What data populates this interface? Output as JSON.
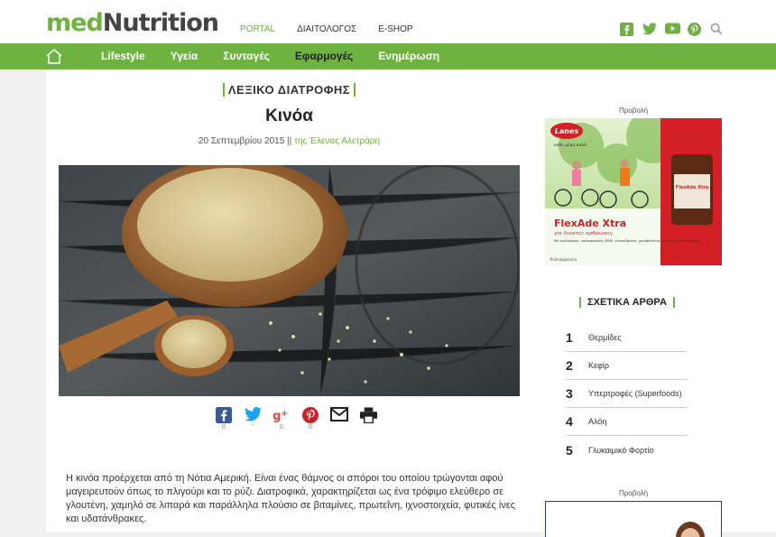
{
  "header": {
    "logo_med": "med",
    "logo_nutrition": "Nutrition",
    "nav": [
      "PORTAL",
      "ΔΙΑΙΤΟΛΟΓΟΣ",
      "E-SHOP"
    ],
    "social_icons": [
      "facebook-icon",
      "twitter-icon",
      "youtube-icon",
      "pinterest-icon",
      "search-icon"
    ]
  },
  "main_nav": [
    "Lifestyle",
    "Υγεία",
    "Συνταγές",
    "Εφαρμογές",
    "Ενημέρωση"
  ],
  "article": {
    "category": "ΛΕΞΙΚΟ ΔΙΑΤΡΟΦΗΣ",
    "title": "Κινόα",
    "date": "20 Σεπτεμβρίου 2015 ||",
    "author": "της Έλενας Αλετράρη",
    "share": [
      {
        "icon": "facebook-icon",
        "count": "0"
      },
      {
        "icon": "twitter-icon",
        "count": "-"
      },
      {
        "icon": "googleplus-icon",
        "count": "0"
      },
      {
        "icon": "pinterest-icon",
        "count": "0"
      },
      {
        "icon": "mail-icon",
        "count": ""
      },
      {
        "icon": "print-icon",
        "count": ""
      }
    ],
    "body": "Η κινόα προέρχεται από τη Νότια Αμερική. Είναι ένας θάμνος οι σπόροι του οποίου τρώγονται αφού μαγειρευτούν όπως το πλιγούρι και το ρύζι. Διατροφικά, χαρακτηρίζεται ως ένα τρόφιμο ελεύθερο σε γλουτένη, χαμηλό σε λιπαρά και παράλληλα πλούσιο σε βιταμίνες, πρωτεΐνη, ιχνοστοιχεία, φυτικές ίνες και υδατάνθρακες."
  },
  "sidebar": {
    "ad_label": "Προβολή",
    "ad": {
      "brand": "Lanes",
      "tagline": "κάθε μέρα καλά",
      "product": "FlexAde Xtra",
      "subtitle": "για δυνατές αρθρώσεις.",
      "description": "Με κολλαγόνο, υαλουρονικό, MSM, γλυκοζαμίνη, χονδροϊτίνη, μαγγάνιο & βιταμίνη C.",
      "hashtag": "#elmaigiasena",
      "bottle_label": "FlexAde Xtra"
    },
    "related_title": "ΣΧΕΤΙΚΑ ΑΡΘΡΑ",
    "related": [
      {
        "num": "1",
        "title": "Θερμίδες"
      },
      {
        "num": "2",
        "title": "Κεφίρ"
      },
      {
        "num": "3",
        "title": "Υπερτροφές (Superfoods)"
      },
      {
        "num": "4",
        "title": "Αλόη"
      },
      {
        "num": "5",
        "title": "Γλυκαιμικό Φορτίο"
      }
    ],
    "ad2_label": "Προβολή"
  },
  "colors": {
    "brand_green": "#6eb33f",
    "lanes_red": "#d41f26"
  }
}
